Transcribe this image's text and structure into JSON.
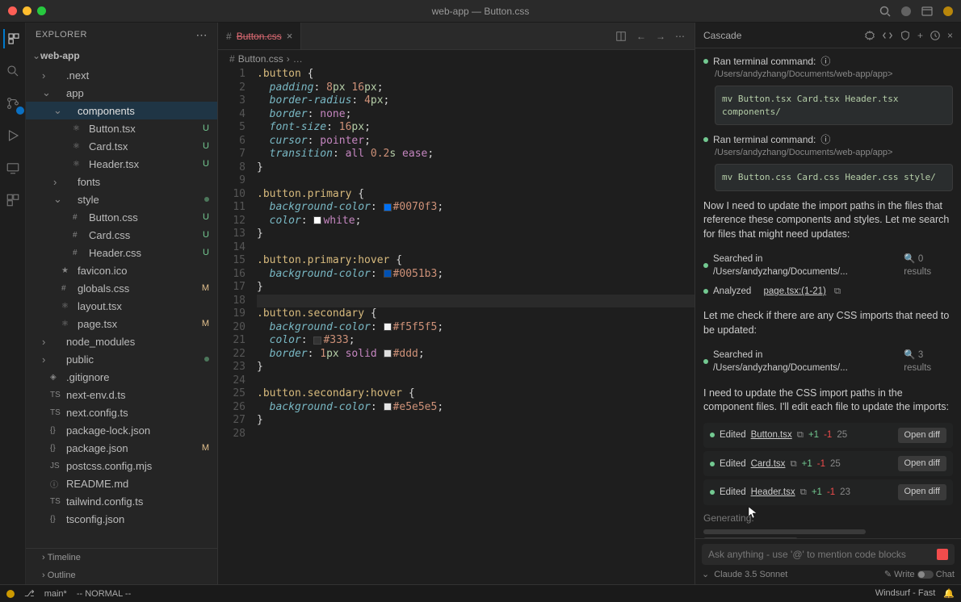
{
  "window": {
    "title": "web-app — Button.css"
  },
  "sidebar": {
    "header": "Explorer",
    "root": "web-app",
    "sections": {
      "timeline": "Timeline",
      "outline": "Outline"
    },
    "tree": [
      {
        "label": ".next",
        "indent": 1,
        "chev": "›",
        "icon": ""
      },
      {
        "label": "app",
        "indent": 1,
        "chev": "⌄",
        "icon": ""
      },
      {
        "label": "components",
        "indent": 2,
        "chev": "⌄",
        "icon": "",
        "active": true
      },
      {
        "label": "Button.tsx",
        "indent": 3,
        "icon": "⚛",
        "status": "U"
      },
      {
        "label": "Card.tsx",
        "indent": 3,
        "icon": "⚛",
        "status": "U"
      },
      {
        "label": "Header.tsx",
        "indent": 3,
        "icon": "⚛",
        "status": "U"
      },
      {
        "label": "fonts",
        "indent": 2,
        "chev": "›",
        "icon": ""
      },
      {
        "label": "style",
        "indent": 2,
        "chev": "⌄",
        "icon": "",
        "dot": true
      },
      {
        "label": "Button.css",
        "indent": 3,
        "icon": "#",
        "status": "U"
      },
      {
        "label": "Card.css",
        "indent": 3,
        "icon": "#",
        "status": "U"
      },
      {
        "label": "Header.css",
        "indent": 3,
        "icon": "#",
        "status": "U"
      },
      {
        "label": "favicon.ico",
        "indent": 2,
        "icon": "★"
      },
      {
        "label": "globals.css",
        "indent": 2,
        "icon": "#",
        "status": "M"
      },
      {
        "label": "layout.tsx",
        "indent": 2,
        "icon": "⚛"
      },
      {
        "label": "page.tsx",
        "indent": 2,
        "icon": "⚛",
        "status": "M"
      },
      {
        "label": "node_modules",
        "indent": 1,
        "chev": "›",
        "icon": ""
      },
      {
        "label": "public",
        "indent": 1,
        "chev": "›",
        "icon": "",
        "dot": true
      },
      {
        "label": ".gitignore",
        "indent": 1,
        "icon": "◈"
      },
      {
        "label": "next-env.d.ts",
        "indent": 1,
        "icon": "TS"
      },
      {
        "label": "next.config.ts",
        "indent": 1,
        "icon": "TS"
      },
      {
        "label": "package-lock.json",
        "indent": 1,
        "icon": "{}"
      },
      {
        "label": "package.json",
        "indent": 1,
        "icon": "{}",
        "status": "M"
      },
      {
        "label": "postcss.config.mjs",
        "indent": 1,
        "icon": "JS"
      },
      {
        "label": "README.md",
        "indent": 1,
        "icon": "ⓘ"
      },
      {
        "label": "tailwind.config.ts",
        "indent": 1,
        "icon": "TS"
      },
      {
        "label": "tsconfig.json",
        "indent": 1,
        "icon": "{}"
      }
    ]
  },
  "editor": {
    "tab_icon": "#",
    "tab_name": "Button.css",
    "breadcrumb_file": "Button.css",
    "breadcrumb_sep": "›",
    "breadcrumb_more": "…",
    "code": [
      {
        "n": 1,
        "html": "<span class='tok-sel'>.button</span> <span class='tok-punct'>{</span>"
      },
      {
        "n": 2,
        "html": "  <span class='tok-prop'>padding</span><span class='tok-punct'>:</span> <span class='tok-num'>8</span><span class='tok-unit'>px</span> <span class='tok-num'>16</span><span class='tok-unit'>px</span><span class='tok-punct'>;</span>"
      },
      {
        "n": 3,
        "html": "  <span class='tok-prop'>border-radius</span><span class='tok-punct'>:</span> <span class='tok-num'>4</span><span class='tok-unit'>px</span><span class='tok-punct'>;</span>"
      },
      {
        "n": 4,
        "html": "  <span class='tok-prop'>border</span><span class='tok-punct'>:</span> <span class='tok-kw'>none</span><span class='tok-punct'>;</span>"
      },
      {
        "n": 5,
        "html": "  <span class='tok-prop'>font-size</span><span class='tok-punct'>:</span> <span class='tok-num'>16</span><span class='tok-unit'>px</span><span class='tok-punct'>;</span>"
      },
      {
        "n": 6,
        "html": "  <span class='tok-prop'>cursor</span><span class='tok-punct'>:</span> <span class='tok-kw'>pointer</span><span class='tok-punct'>;</span>"
      },
      {
        "n": 7,
        "html": "  <span class='tok-prop'>transition</span><span class='tok-punct'>:</span> <span class='tok-kw'>all</span> <span class='tok-num'>0.2</span><span class='tok-unit'>s</span> <span class='tok-kw'>ease</span><span class='tok-punct'>;</span>"
      },
      {
        "n": 8,
        "html": "<span class='tok-punct'>}</span>"
      },
      {
        "n": 9,
        "html": ""
      },
      {
        "n": 10,
        "html": "<span class='tok-sel'>.button.primary</span> <span class='tok-punct'>{</span>"
      },
      {
        "n": 11,
        "html": "  <span class='tok-prop'>background-color</span><span class='tok-punct'>:</span> <span class='color-swatch' style='background:#0070f3'></span><span class='tok-str'>#0070f3</span><span class='tok-punct'>;</span>"
      },
      {
        "n": 12,
        "html": "  <span class='tok-prop'>color</span><span class='tok-punct'>:</span> <span class='color-swatch' style='background:#fff'></span><span class='tok-kw'>white</span><span class='tok-punct'>;</span>"
      },
      {
        "n": 13,
        "html": "<span class='tok-punct'>}</span>"
      },
      {
        "n": 14,
        "html": ""
      },
      {
        "n": 15,
        "html": "<span class='tok-sel'>.button.primary:hover</span> <span class='tok-punct'>{</span>"
      },
      {
        "n": 16,
        "html": "  <span class='tok-prop'>background-color</span><span class='tok-punct'>:</span> <span class='color-swatch' style='background:#0051b3'></span><span class='tok-str'>#0051b3</span><span class='tok-punct'>;</span>"
      },
      {
        "n": 17,
        "html": "<span class='tok-punct'>}</span>"
      },
      {
        "n": 18,
        "html": "",
        "cursor": true
      },
      {
        "n": 19,
        "html": "<span class='tok-sel'>.button.secondary</span> <span class='tok-punct'>{</span>"
      },
      {
        "n": 20,
        "html": "  <span class='tok-prop'>background-color</span><span class='tok-punct'>:</span> <span class='color-swatch' style='background:#f5f5f5'></span><span class='tok-str'>#f5f5f5</span><span class='tok-punct'>;</span>"
      },
      {
        "n": 21,
        "html": "  <span class='tok-prop'>color</span><span class='tok-punct'>:</span> <span class='color-swatch' style='background:#333'></span><span class='tok-str'>#333</span><span class='tok-punct'>;</span>"
      },
      {
        "n": 22,
        "html": "  <span class='tok-prop'>border</span><span class='tok-punct'>:</span> <span class='tok-num'>1</span><span class='tok-unit'>px</span> <span class='tok-kw'>solid</span> <span class='color-swatch' style='background:#ddd'></span><span class='tok-str'>#ddd</span><span class='tok-punct'>;</span>"
      },
      {
        "n": 23,
        "html": "<span class='tok-punct'>}</span>"
      },
      {
        "n": 24,
        "html": ""
      },
      {
        "n": 25,
        "html": "<span class='tok-sel'>.button.secondary:hover</span> <span class='tok-punct'>{</span>"
      },
      {
        "n": 26,
        "html": "  <span class='tok-prop'>background-color</span><span class='tok-punct'>:</span> <span class='color-swatch' style='background:#e5e5e5'></span><span class='tok-str'>#e5e5e5</span><span class='tok-punct'>;</span>"
      },
      {
        "n": 27,
        "html": "<span class='tok-punct'>}</span>"
      },
      {
        "n": 28,
        "html": ""
      }
    ]
  },
  "cascade": {
    "title": "Cascade",
    "ran_terminal_label": "Ran terminal command:",
    "path_line": "/Users/andyzhang/Documents/web-app/app>",
    "cmd1": "mv Button.tsx Card.tsx Header.tsx components/",
    "cmd2": "mv Button.css Card.css Header.css style/",
    "p1": "Now I need to update the import paths in the files that reference these components and styles. Let me search for files that might need updates:",
    "search1": "Searched in /Users/andyzhang/Documents/...",
    "search1_count": "0 results",
    "analyzed": "Analyzed",
    "analyzed_file": "page.tsx:(1-21)",
    "p2": "Let me check if there are any CSS imports that need to be updated:",
    "search2": "Searched in /Users/andyzhang/Documents/...",
    "search2_count": "3 results",
    "p3": "I need to update the CSS import paths in the component files. I'll edit each file to update the imports:",
    "edits": [
      {
        "label": "Edited",
        "file": "Button.tsx",
        "plus": "+1",
        "minus": "-1",
        "count": "25"
      },
      {
        "label": "Edited",
        "file": "Card.tsx",
        "plus": "+1",
        "minus": "-1",
        "count": "25"
      },
      {
        "label": "Edited",
        "file": "Header.tsx",
        "plus": "+1",
        "minus": "-1",
        "count": "23"
      }
    ],
    "open_diff": "Open diff",
    "generating": "Generating.",
    "input_placeholder": "Ask anything - use '@' to mention code blocks",
    "model": "Claude 3.5 Sonnet",
    "write_label": "Write",
    "chat_label": "Chat"
  },
  "statusbar": {
    "branch": "main*",
    "mode": "-- NORMAL --",
    "right_label": "Windsurf - Fast"
  }
}
